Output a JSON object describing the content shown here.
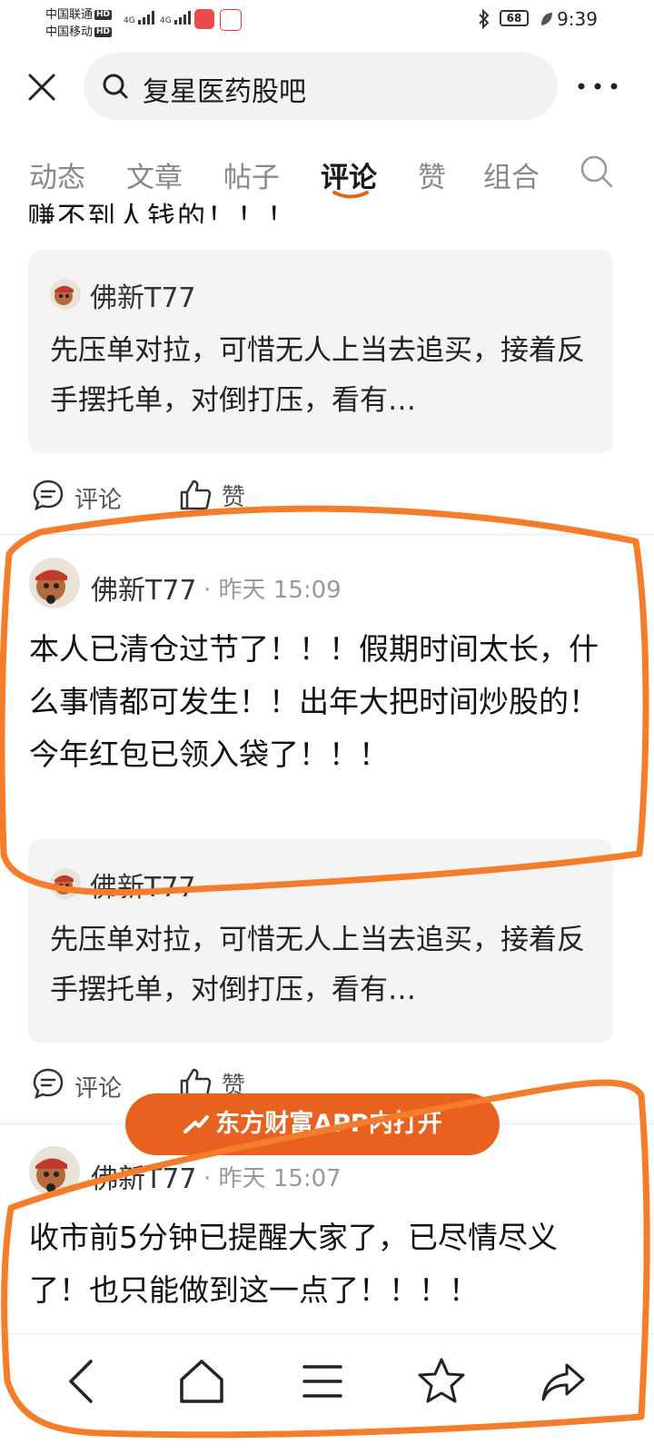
{
  "status_bar": {
    "carrier1": "中国联通",
    "carrier2": "中国移动",
    "hd": "HD",
    "net": "4G",
    "battery": "68",
    "time": "9:39"
  },
  "search": {
    "query": "复星医药股吧"
  },
  "tabs": [
    {
      "label": "动态"
    },
    {
      "label": "文章"
    },
    {
      "label": "帖子"
    },
    {
      "label": "评论",
      "active": true
    },
    {
      "label": "赞"
    },
    {
      "label": "组合"
    }
  ],
  "cut_text": "赚不到人钱的！！！",
  "quote1": {
    "name": "佛新T77",
    "text": "先压单对拉，可惜无人上当去追买，接着反手摆托单，对倒打压，看有…"
  },
  "actions": {
    "comment": "评论",
    "like": "赞"
  },
  "posts": [
    {
      "name": "佛新T77",
      "meta": "· 昨天 15:09",
      "text": "本人已清仓过节了！！！假期时间太长，什么事情都可发生！！出年大把时间炒股的！今年红包已领入袋了！！！",
      "quote_name": "佛新T77",
      "quote_text": "先压单对拉，可惜无人上当去追买，接着反手摆托单，对倒打压，看有…"
    },
    {
      "name": "佛新T77",
      "meta": "· 昨天 15:07",
      "text": "收市前5分钟已提醒大家了，已尽情尽义了！也只能做到这一点了！！！！"
    }
  ],
  "open_app_button": "东方财富APP内打开",
  "colors": {
    "accent": "#e8611e",
    "annotation": "#f47c2a",
    "quote_bg": "#f4f4f4"
  }
}
